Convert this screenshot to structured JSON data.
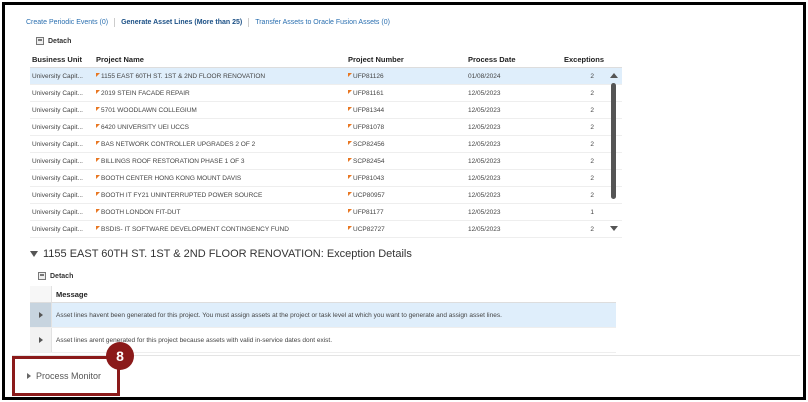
{
  "tabs": [
    {
      "label": "Create Periodic Events (0)",
      "active": false
    },
    {
      "label": "Generate Asset Lines (More than 25)",
      "active": true
    },
    {
      "label": "Transfer Assets to Oracle Fusion Assets (0)",
      "active": false
    }
  ],
  "top_detach_label": "Detach",
  "grid": {
    "columns": [
      "Business Unit",
      "Project Name",
      "Project Number",
      "Process Date",
      "Exceptions"
    ],
    "rows": [
      {
        "bu": "University Capit...",
        "name": "1155 EAST 60TH ST. 1ST & 2ND FLOOR RENOVATION",
        "number": "UFP81126",
        "date": "01/08/2024",
        "exceptions": "2"
      },
      {
        "bu": "University Capit...",
        "name": "2019 STEIN FACADE REPAIR",
        "number": "UFP81161",
        "date": "12/05/2023",
        "exceptions": "2"
      },
      {
        "bu": "University Capit...",
        "name": "5701 WOODLAWN COLLEGIUM",
        "number": "UFP81344",
        "date": "12/05/2023",
        "exceptions": "2"
      },
      {
        "bu": "University Capit...",
        "name": "6420 UNIVERSITY UEI UCCS",
        "number": "UFP81078",
        "date": "12/05/2023",
        "exceptions": "2"
      },
      {
        "bu": "University Capit...",
        "name": "BAS NETWORK CONTROLLER UPGRADES 2 OF 2",
        "number": "SCP82456",
        "date": "12/05/2023",
        "exceptions": "2"
      },
      {
        "bu": "University Capit...",
        "name": "BILLINGS ROOF RESTORATION PHASE 1 OF 3",
        "number": "SCP82454",
        "date": "12/05/2023",
        "exceptions": "2"
      },
      {
        "bu": "University Capit...",
        "name": "BOOTH CENTER HONG KONG MOUNT DAVIS",
        "number": "UFP81043",
        "date": "12/05/2023",
        "exceptions": "2"
      },
      {
        "bu": "University Capit...",
        "name": "BOOTH IT FY21 UNINTERRUPTED POWER SOURCE",
        "number": "UCP80957",
        "date": "12/05/2023",
        "exceptions": "2"
      },
      {
        "bu": "University Capit...",
        "name": "BOOTH LONDON FIT-DUT",
        "number": "UFP81177",
        "date": "12/05/2023",
        "exceptions": "1"
      },
      {
        "bu": "University Capit...",
        "name": "BSDIS- IT SOFTWARE DEVELOPMENT CONTINGENCY FUND",
        "number": "UCP82727",
        "date": "12/05/2023",
        "exceptions": "2"
      }
    ]
  },
  "details": {
    "title": "1155 EAST 60TH ST. 1ST & 2ND FLOOR RENOVATION: Exception Details",
    "detach_label": "Detach",
    "message_header": "Message",
    "messages": [
      "Asset lines havent been generated for this project. You must assign assets at the project or task level at which you want to generate and assign asset lines.",
      "Asset lines arent generated for this project because assets with valid in-service dates dont exist."
    ]
  },
  "process_monitor_label": "Process Monitor",
  "step_badge": "8",
  "colors": {
    "accent_link": "#2a6fb0",
    "selected_row": "#dfeefb",
    "highlight": "#8b1a1a",
    "flag": "#e87722"
  }
}
